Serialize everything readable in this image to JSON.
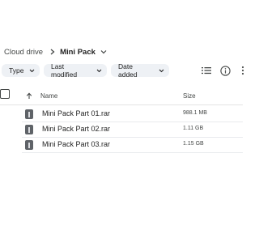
{
  "breadcrumb": {
    "root": "Cloud drive",
    "current": "Mini Pack"
  },
  "filters": {
    "type": "Type",
    "last_modified": "Last modified",
    "date_added": "Date added"
  },
  "toolbar": {
    "list_view_icon": "list-view-icon",
    "info_icon": "info-icon",
    "more_icon": "more-vert-icon"
  },
  "table": {
    "columns": [
      "Name",
      "Size"
    ],
    "rows": [
      {
        "name": "Mini Pack Part 01.rar",
        "size": "988.1 MB"
      },
      {
        "name": "Mini Pack Part 02.rar",
        "size": "1.11 GB"
      },
      {
        "name": "Mini Pack Part 03.rar",
        "size": "1.15 GB"
      }
    ]
  },
  "colors": {
    "chip_background": "#eef1f5",
    "file_icon": "#5f6368",
    "text_primary": "#1f1f1f",
    "text_secondary": "#444746"
  }
}
